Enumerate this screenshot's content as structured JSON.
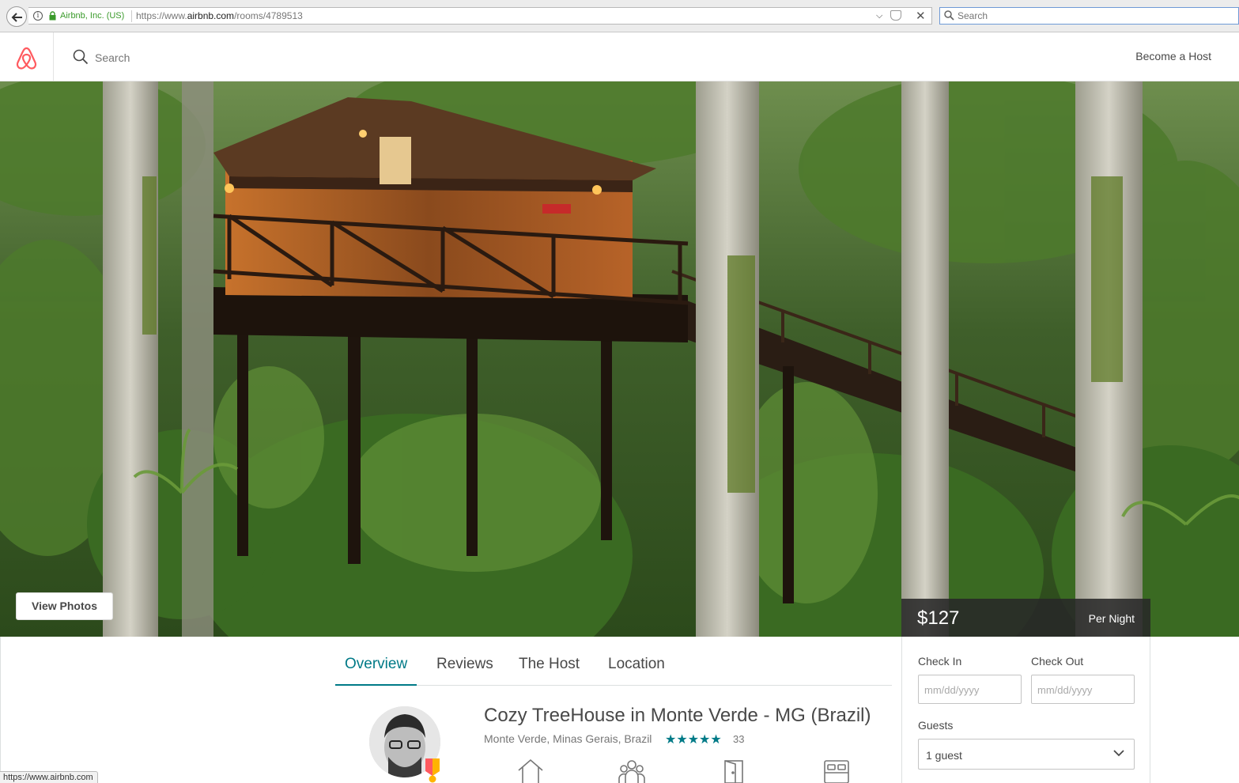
{
  "browser": {
    "site_identity": "Airbnb, Inc. (US)",
    "url_prefix": "https://www.",
    "url_domain": "airbnb.com",
    "url_path": "/rooms/4789513",
    "search_placeholder": "Search",
    "status_url": "https://www.airbnb.com"
  },
  "header": {
    "search_placeholder": "Search",
    "become_host": "Become a Host",
    "brand_color": "#ff5a5f"
  },
  "hero": {
    "view_photos": "View Photos"
  },
  "booking": {
    "price": "$127",
    "per_night": "Per Night",
    "check_in_label": "Check In",
    "check_out_label": "Check Out",
    "date_placeholder": "mm/dd/yyyy",
    "guests_label": "Guests",
    "guests_value": "1 guest"
  },
  "tabs": [
    {
      "label": "Overview",
      "active": true
    },
    {
      "label": "Reviews",
      "active": false
    },
    {
      "label": "The Host",
      "active": false
    },
    {
      "label": "Location",
      "active": false
    }
  ],
  "listing": {
    "title": "Cozy TreeHouse in Monte Verde - MG (Brazil)",
    "location": "Monte Verde, Minas Gerais, Brazil",
    "rating_stars": 5,
    "review_count": "33",
    "accent_color": "#007a87",
    "amenity_icons": [
      "home-icon",
      "guests-icon",
      "door-icon",
      "bed-icon"
    ]
  }
}
